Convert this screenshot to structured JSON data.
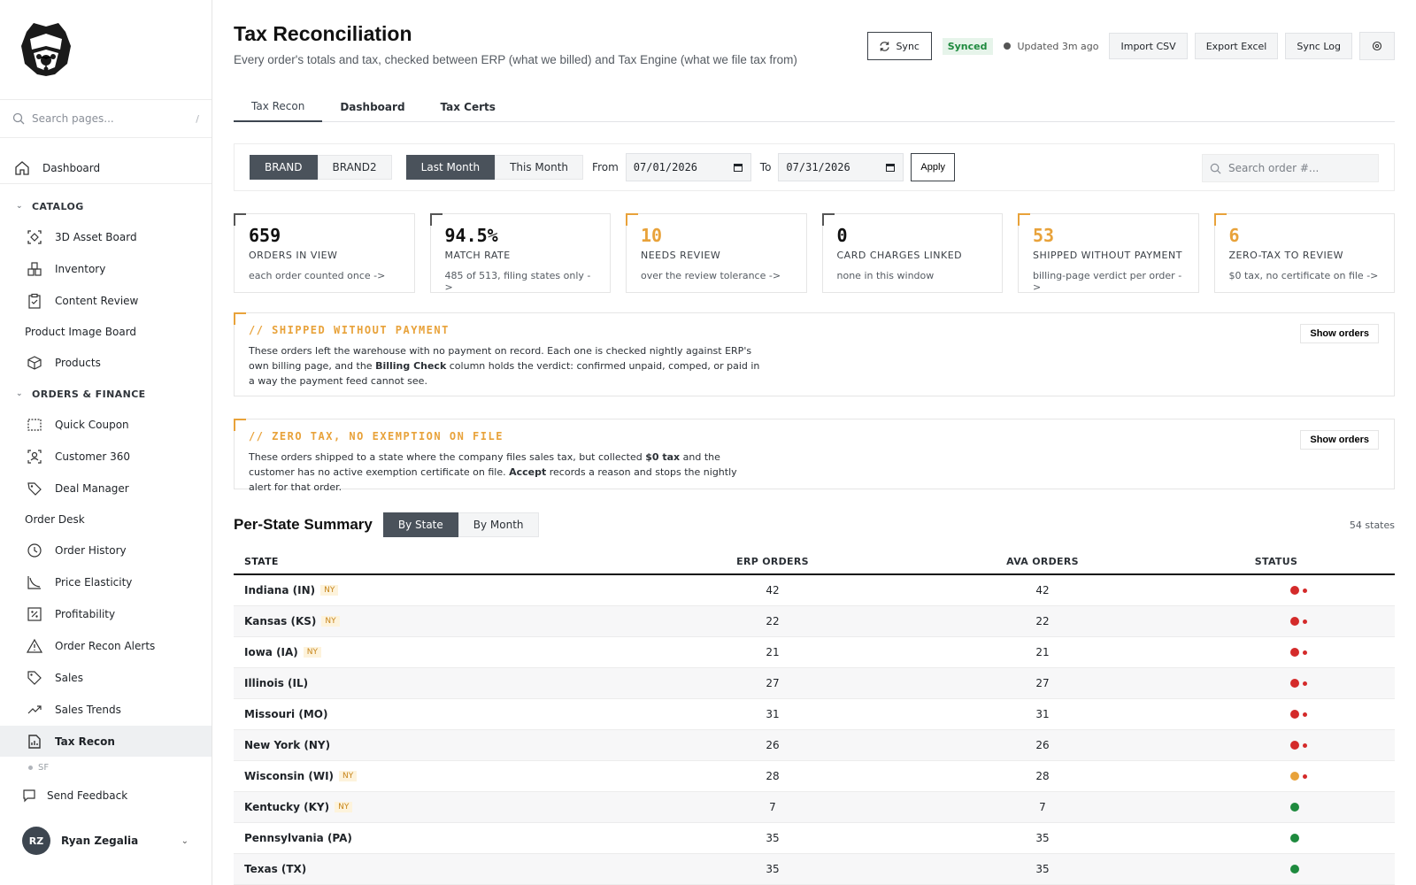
{
  "colors": {
    "accent": "#4a525b",
    "warn": "#e8a23a",
    "danger": "#d42a2a",
    "ok": "#1e8a3e"
  },
  "sidebar": {
    "search_placeholder": "Search pages...",
    "search_kbd": "/",
    "dashboard": "Dashboard",
    "catalog_header": "CATALOG",
    "catalog_items": [
      "3D Asset Board",
      "Inventory",
      "Content Review"
    ],
    "product_image_board": "Product Image Board",
    "products": "Products",
    "orders_header": "ORDERS & FINANCE",
    "orders_items": [
      "Quick Coupon",
      "Customer 360",
      "Deal Manager"
    ],
    "order_desk": "Order Desk",
    "orders_items2": [
      "Order History",
      "Price Elasticity",
      "Profitability",
      "Order Recon Alerts",
      "Sales",
      "Sales Trends",
      "Tax Recon"
    ],
    "env": "SF",
    "feedback": "Send Feedback",
    "user_initials": "RZ",
    "user_name": "Ryan Zegalia"
  },
  "header": {
    "title": "Tax Reconciliation",
    "subtitle": "Every order's totals and tax, checked between ERP (what we billed) and Tax Engine (what we file tax from)",
    "sync": "Sync",
    "synced": "Synced",
    "updated": "Updated 3m ago",
    "import": "Import CSV",
    "export": "Export Excel",
    "sync_log": "Sync Log"
  },
  "tabs": [
    "Tax Recon",
    "Dashboard",
    "Tax Certs"
  ],
  "filters": {
    "brands": [
      "BRAND",
      "BRAND2"
    ],
    "periods": [
      "Last Month",
      "This Month"
    ],
    "from_label": "From",
    "from": "07/01/2026",
    "to_label": "To",
    "to": "07/31/2026",
    "apply": "Apply",
    "search_placeholder": "Search order #..."
  },
  "kpis": [
    {
      "value": "659",
      "label": "ORDERS IN VIEW",
      "desc": "each order counted once ->",
      "warn": false
    },
    {
      "value": "94.5%",
      "label": "MATCH RATE",
      "desc": "485 of 513, filing states only ->",
      "warn": false
    },
    {
      "value": "10",
      "label": "NEEDS REVIEW",
      "desc": "over the review tolerance ->",
      "warn": true
    },
    {
      "value": "0",
      "label": "CARD CHARGES LINKED",
      "desc": "none in this window",
      "warn": false
    },
    {
      "value": "53",
      "label": "SHIPPED WITHOUT PAYMENT",
      "desc": "billing-page verdict per order ->",
      "warn": true
    },
    {
      "value": "6",
      "label": "ZERO-TAX TO REVIEW",
      "desc": "$0 tax, no certificate on file ->",
      "warn": true
    }
  ],
  "alerts": {
    "shipped": {
      "title": "// SHIPPED WITHOUT PAYMENT",
      "body_a": "These orders left the warehouse with no payment on record. Each one is checked nightly against ERP's own billing page, and the ",
      "body_b": "Billing Check",
      "body_c": " column holds the verdict: confirmed unpaid, comped, or paid in a way the payment feed cannot see.",
      "button": "Show orders"
    },
    "zerotax": {
      "title": "// ZERO TAX, NO EXEMPTION ON FILE",
      "body_a": "These orders shipped to a state where the company files sales tax, but collected ",
      "body_b": "$0 tax",
      "body_c": " and the customer has no active exemption certificate on file. ",
      "body_d": "Accept",
      "body_e": " records a reason and stops the nightly alert for that order.",
      "button": "Show orders"
    }
  },
  "summary": {
    "title": "Per-State Summary",
    "views": [
      "By State",
      "By Month"
    ],
    "count": "54 states",
    "columns": [
      "STATE",
      "ERP ORDERS",
      "AVA ORDERS",
      "STATUS"
    ],
    "rows": [
      {
        "state": "Indiana (IN)",
        "tag": "NY",
        "erp": "42",
        "ava": "42",
        "status": "red-alert"
      },
      {
        "state": "Kansas (KS)",
        "tag": "NY",
        "erp": "22",
        "ava": "22",
        "status": "red-alert"
      },
      {
        "state": "Iowa (IA)",
        "tag": "NY",
        "erp": "21",
        "ava": "21",
        "status": "red-alert"
      },
      {
        "state": "Illinois (IL)",
        "tag": "",
        "erp": "27",
        "ava": "27",
        "status": "red-alert"
      },
      {
        "state": "Missouri (MO)",
        "tag": "",
        "erp": "31",
        "ava": "31",
        "status": "red-alert"
      },
      {
        "state": "New York (NY)",
        "tag": "",
        "erp": "26",
        "ava": "26",
        "status": "red-alert"
      },
      {
        "state": "Wisconsin (WI)",
        "tag": "NY",
        "erp": "28",
        "ava": "28",
        "status": "orange-alert"
      },
      {
        "state": "Kentucky (KY)",
        "tag": "NY",
        "erp": "7",
        "ava": "7",
        "status": "ok"
      },
      {
        "state": "Pennsylvania (PA)",
        "tag": "",
        "erp": "35",
        "ava": "35",
        "status": "ok"
      },
      {
        "state": "Texas (TX)",
        "tag": "",
        "erp": "35",
        "ava": "35",
        "status": "ok"
      }
    ]
  }
}
